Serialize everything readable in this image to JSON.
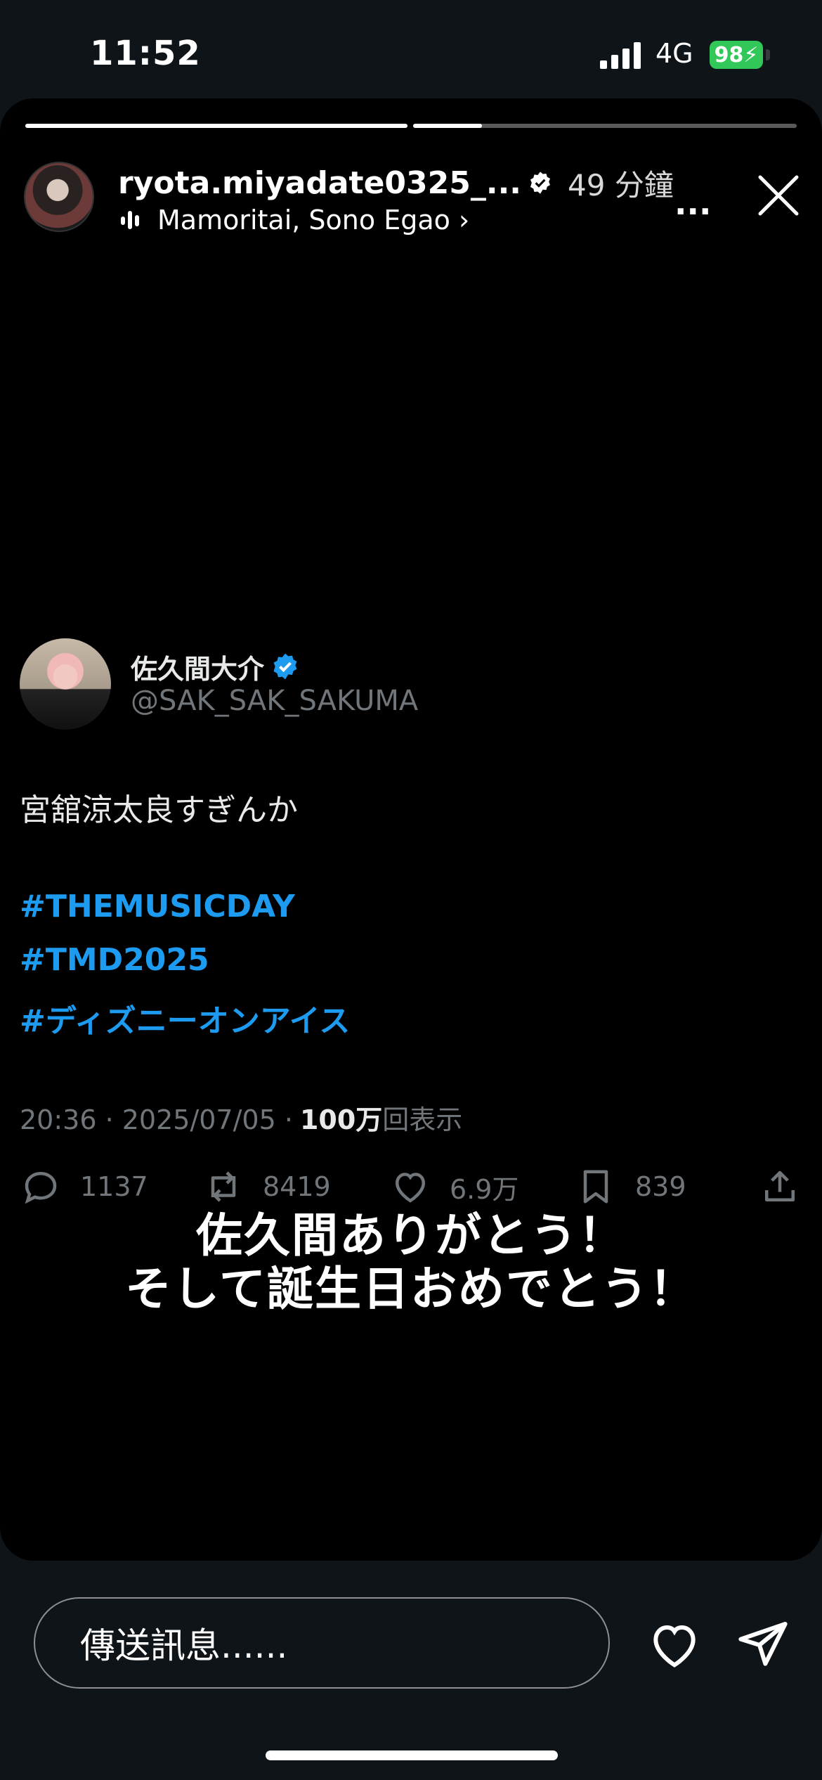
{
  "status_bar": {
    "time": "11:52",
    "network": "4G",
    "battery": "98"
  },
  "story": {
    "progress": [
      1.0,
      0.18
    ],
    "username": "ryota.miyadate0325_...",
    "time_ago": "49 分鐘",
    "music": "Mamoritai, Sono Egao ›",
    "more": "...",
    "tweet": {
      "display_name": "佐久間大介",
      "handle": "@SAK_SAK_SAKUMA",
      "text": "宮舘涼太良すぎんか",
      "hashtags": [
        "#THEMUSICDAY",
        "#TMD2025",
        "#ディズニーオンアイス"
      ],
      "timestamp": "20:36 · 2025/07/05 ·",
      "views_count": "100万",
      "views_label": "回表示",
      "replies": "1137",
      "reposts": "8419",
      "likes": "6.9万",
      "bookmarks": "839"
    },
    "overlay_lines": [
      "佐久間ありがとう！",
      "そして誕生日おめでとう！"
    ]
  },
  "footer": {
    "message_placeholder": "傳送訊息......"
  },
  "colors": {
    "link_blue": "#1d9bf0",
    "battery_green": "#32c759",
    "muted_gray": "#71767b"
  }
}
